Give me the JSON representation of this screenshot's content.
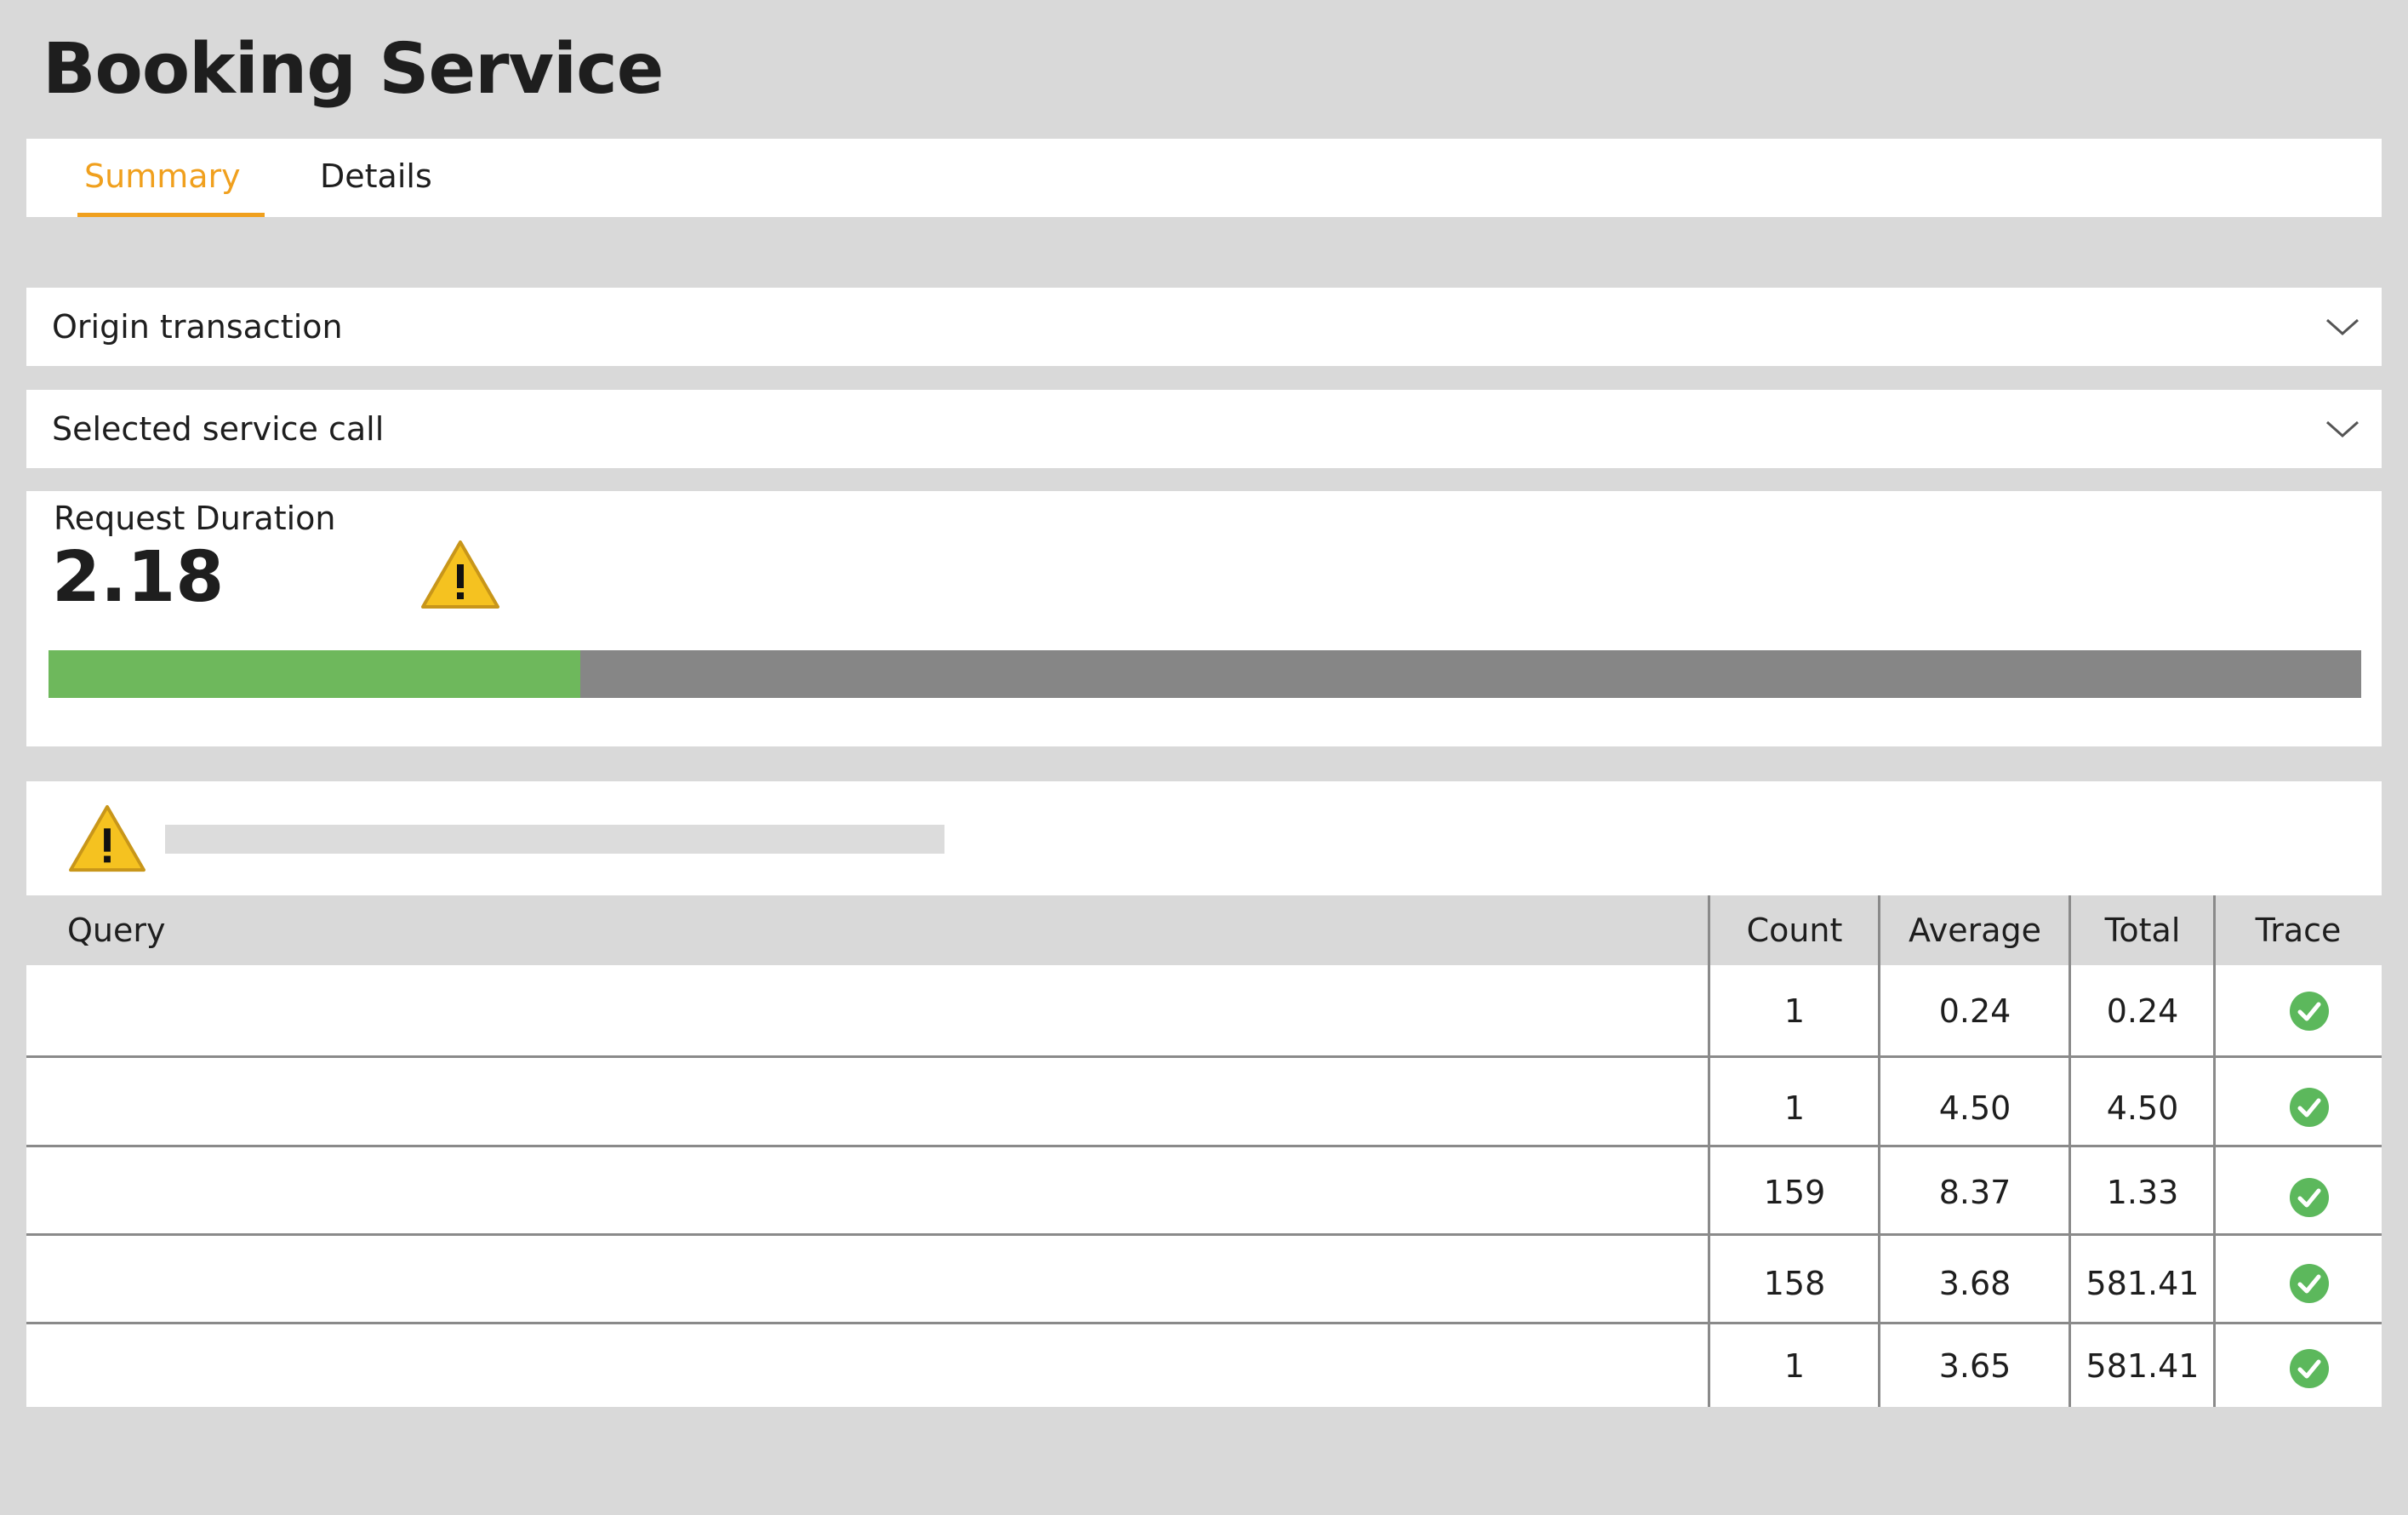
{
  "page": {
    "title": "Booking Service"
  },
  "tabs": [
    {
      "label": "Summary",
      "active": true
    },
    {
      "label": "Details",
      "active": false
    }
  ],
  "accordions": {
    "origin": {
      "label": "Origin transaction",
      "icon": "chevron-down-icon"
    },
    "service": {
      "label": "Selected service call",
      "icon": "chevron-down-icon"
    }
  },
  "duration": {
    "label": "Request Duration",
    "value": "2.18",
    "warning_icon": "warning-icon",
    "progress_fraction": 0.23
  },
  "queries": {
    "warning_icon": "warning-icon",
    "columns": {
      "query": "Query",
      "count": "Count",
      "average": "Average",
      "total": "Total",
      "trace": "Trace"
    },
    "rows": [
      {
        "query": "",
        "count": "1",
        "average": "0.24",
        "total": "0.24",
        "trace": "check-circle-icon"
      },
      {
        "query": "",
        "count": "1",
        "average": "4.50",
        "total": "4.50",
        "trace": "check-circle-icon"
      },
      {
        "query": "",
        "count": "159",
        "average": "8.37",
        "total": "1.33",
        "trace": "check-circle-icon"
      },
      {
        "query": "",
        "count": "158",
        "average": "3.68",
        "total": "581.41",
        "trace": "check-circle-icon"
      },
      {
        "query": "",
        "count": "1",
        "average": "3.65",
        "total": "581.41",
        "trace": "check-circle-icon"
      }
    ]
  },
  "colors": {
    "accent": "#f0a01e",
    "progress_good": "#6eb85c",
    "progress_track": "#868686",
    "warning": "#f5c220",
    "success": "#5cb85c",
    "background": "#d9d9d9"
  }
}
